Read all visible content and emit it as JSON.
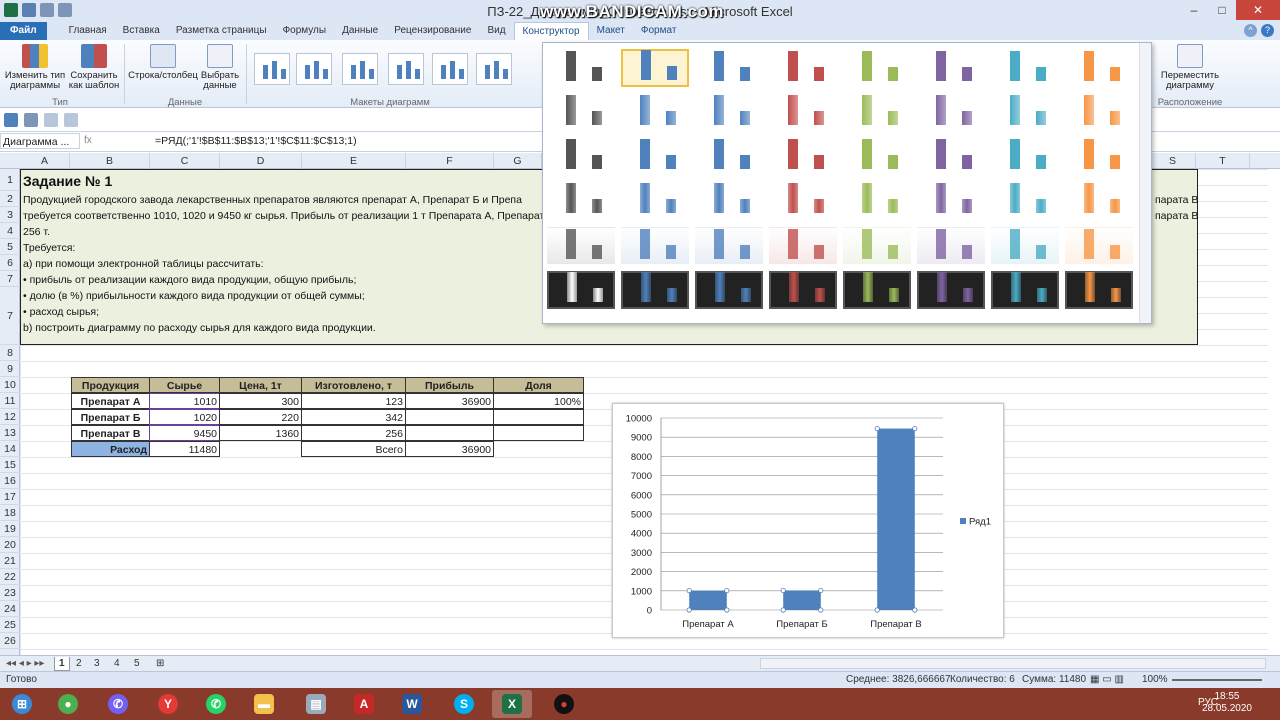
{
  "window": {
    "title": "ПЗ-22_Диаграммы_Основное.xlsx - Microsoft Excel",
    "watermark": "www.BANDICAM.com",
    "buttons": [
      "–",
      "□",
      "✕"
    ]
  },
  "tabs": [
    {
      "label": "Файл"
    },
    {
      "label": "Главная"
    },
    {
      "label": "Вставка"
    },
    {
      "label": "Разметка страницы"
    },
    {
      "label": "Формулы"
    },
    {
      "label": "Данные"
    },
    {
      "label": "Рецензирование"
    },
    {
      "label": "Вид"
    },
    {
      "label": "Конструктор"
    },
    {
      "label": "Макет"
    },
    {
      "label": "Формат"
    }
  ],
  "ribbon": {
    "change_type": "Изменить тип диаграммы",
    "save_template": "Сохранить как шаблон",
    "group_type": "Тип",
    "switch_rowcol": "Строка/столбец",
    "select_data": "Выбрать данные",
    "group_data": "Данные",
    "group_layouts": "Макеты диаграмм",
    "move_chart": "Переместить диаграмму",
    "group_location": "Расположение"
  },
  "formula_bar": {
    "name_box": "Диаграмма ...",
    "fx": "fx",
    "formula": "=РЯД(;'1'!$B$11:$B$13;'1'!$C$11:$C$13;1)"
  },
  "columns": [
    "A",
    "B",
    "C",
    "D",
    "E",
    "F",
    "G",
    "S",
    "T"
  ],
  "rows": [
    "1",
    "2",
    "3",
    "4",
    "5",
    "6",
    "7",
    "8",
    "9",
    "10",
    "11",
    "12",
    "13",
    "14",
    "15",
    "16",
    "17",
    "18",
    "19",
    "20",
    "21",
    "22",
    "23",
    "24",
    "25",
    "26"
  ],
  "task": {
    "title": "Задание № 1",
    "line1": "Продукцией городского  завода лекарственных препаратов являются препарат А, Препарат Б и Препа",
    "line1_right": "парата В",
    "line2": "требуется соответственно 1010, 1020 и 9450 кг сырья. Прибыль от реализации 1 т Препарата А, Препарат",
    "line2_right": "парата В",
    "line3": "256 т.",
    "line4": "Требуется:",
    "line5": "а) при помощи электронной таблицы рассчитать:",
    "line6": "• прибыль от реализации каждого вида продукции, общую прибыль;",
    "line7": "• долю (в %) прибыльности каждого вида продукции от общей суммы;",
    "line8": "• расход сырья;",
    "line9": "b) построить диаграмму по расходу сырья для каждого вида продукции."
  },
  "table": {
    "headers": [
      "Продукция",
      "Сырье",
      "Цена, 1т",
      "Изготовлено, т",
      "Прибыль",
      "Доля"
    ],
    "r1": [
      "Препарат А",
      "1010",
      "300",
      "123",
      "36900",
      "100%"
    ],
    "r2": [
      "Препарат Б",
      "1020",
      "220",
      "342",
      "",
      ""
    ],
    "r3": [
      "Препарат В",
      "9450",
      "1360",
      "256",
      "",
      ""
    ],
    "r4": [
      "Расход",
      "11480",
      "",
      "Всего",
      "36900",
      ""
    ]
  },
  "chart_data": {
    "type": "bar",
    "categories": [
      "Препарат А",
      "Препарат Б",
      "Препарат В"
    ],
    "series": [
      {
        "name": "Ряд1",
        "values": [
          1010,
          1020,
          9450
        ]
      }
    ],
    "ylim": [
      0,
      10000
    ],
    "yticks": [
      "0",
      "1000",
      "2000",
      "3000",
      "4000",
      "5000",
      "6000",
      "7000",
      "8000",
      "9000",
      "10000"
    ],
    "grid": true,
    "legend": "right",
    "color": "#4f81bd"
  },
  "gallery": {
    "colors": [
      "#555555",
      "#4f81bd",
      "#4f81bd",
      "#c0504d",
      "#9bbb59",
      "#8064a2",
      "#4bacc6",
      "#f79646"
    ]
  },
  "sheets": [
    "1",
    "2",
    "3",
    "4",
    "5"
  ],
  "status": {
    "ready": "Готово",
    "average": "Среднее: 3826,666667",
    "count": "Количество: 6",
    "sum": "Сумма: 11480",
    "zoom": "100%"
  },
  "taskbar": {
    "lang": "РУС",
    "time": "18:55",
    "date": "28.05.2020"
  }
}
